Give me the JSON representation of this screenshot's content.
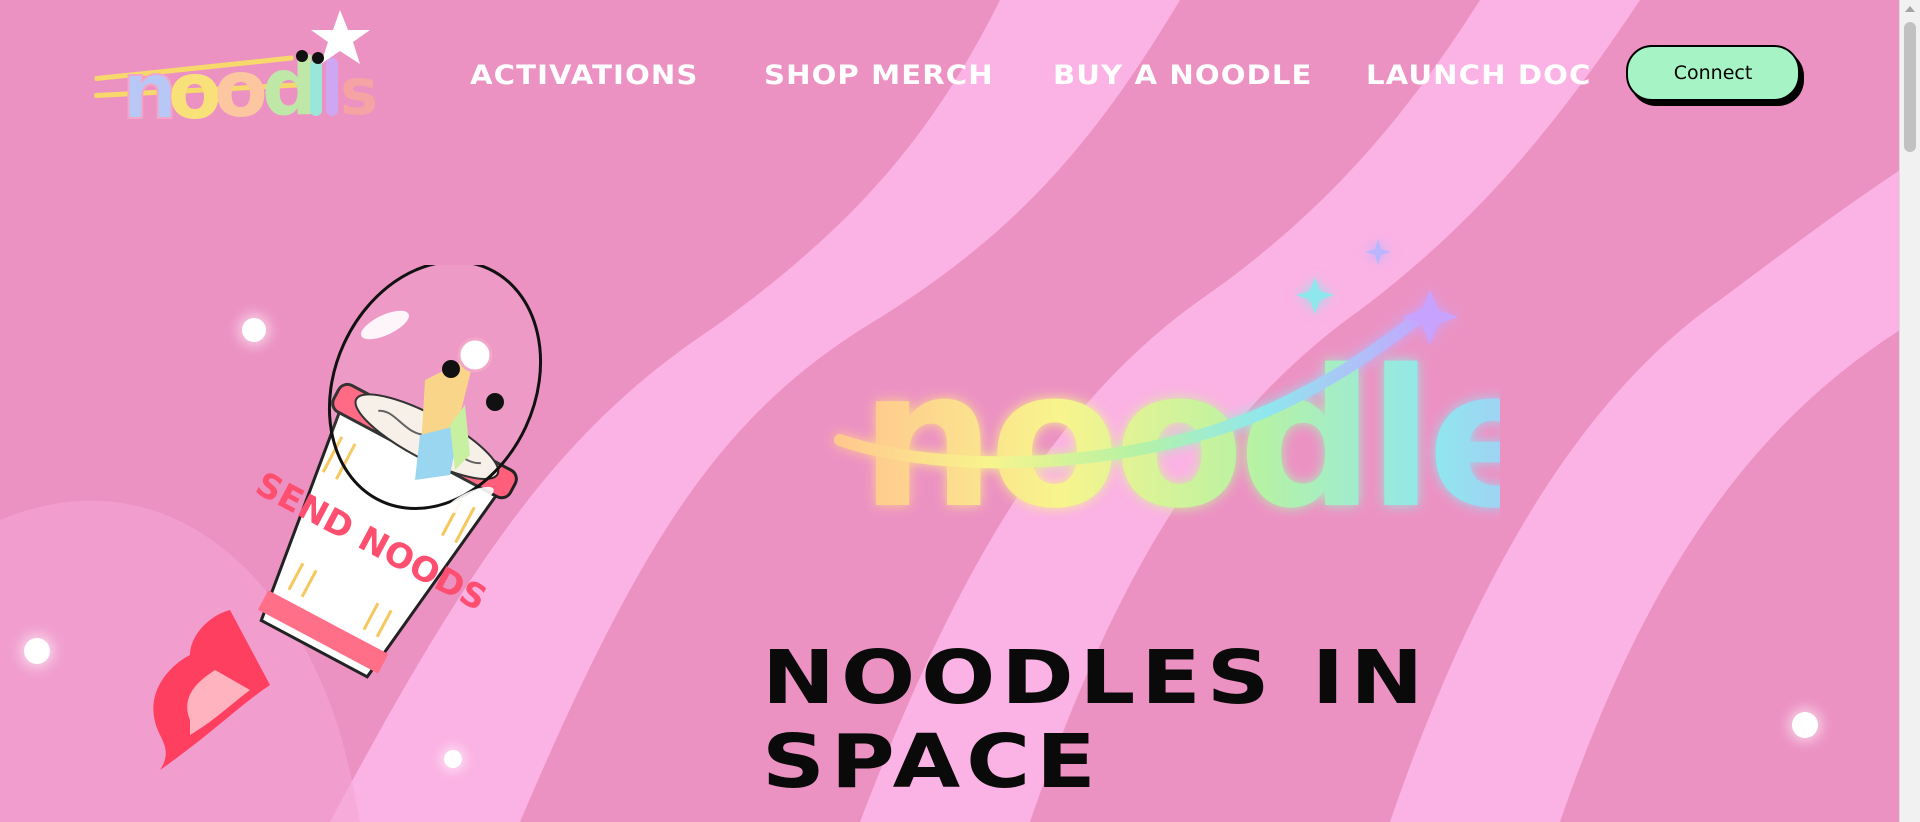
{
  "header": {
    "logo_icon": "noodles-logo",
    "nav": [
      {
        "label": "ACTIVATIONS"
      },
      {
        "label": "SHOP MERCH"
      },
      {
        "label": "BUY A NOODLE"
      },
      {
        "label": "LAUNCH DOC"
      }
    ],
    "connect_label": "Connect"
  },
  "hero": {
    "title_line1": "NOODLES IN",
    "title_line2": "SPACE",
    "illustration_icon": "noodle-cup-rocket",
    "cup_text": "SEND NOODS",
    "logo_icon": "noodles-rainbow-logo"
  },
  "colors": {
    "background": "#ee94c4",
    "stripe": "#fbb3e4",
    "connect_bg": "#a6f3c5",
    "nav_text": "#ffffff",
    "title_text": "#0a0a0a"
  }
}
